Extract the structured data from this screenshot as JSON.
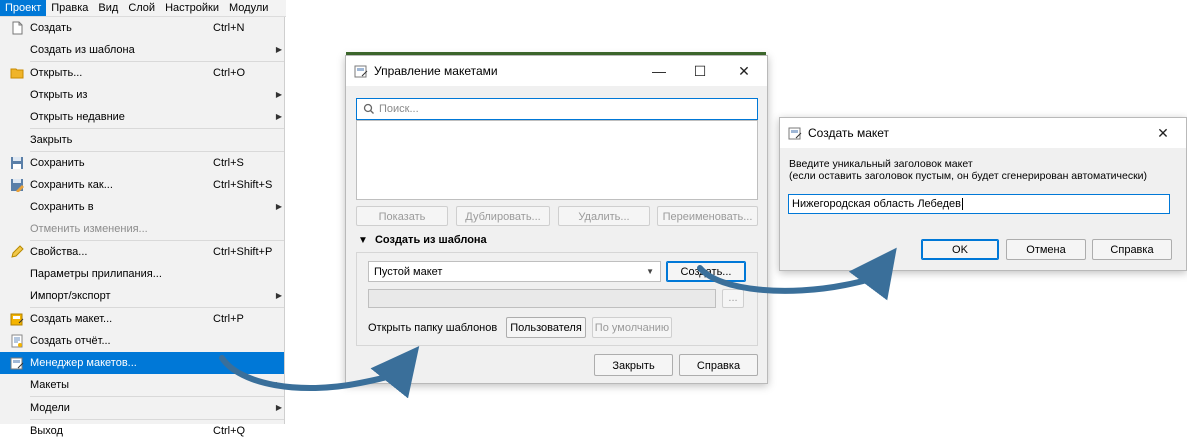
{
  "menubar": {
    "items": [
      "Проект",
      "Правка",
      "Вид",
      "Слой",
      "Настройки",
      "Модули"
    ]
  },
  "menu": {
    "items": [
      {
        "label": "Создать",
        "shortcut": "Ctrl+N",
        "icon": "new-file-icon"
      },
      {
        "label": "Создать из шаблона",
        "submenu": "▶"
      },
      {
        "label": "Открыть...",
        "shortcut": "Ctrl+O",
        "icon": "folder-icon"
      },
      {
        "label": "Открыть из",
        "submenu": "▶"
      },
      {
        "label": "Открыть недавние",
        "submenu": "▶"
      },
      {
        "label": "Закрыть"
      },
      {
        "label": "Сохранить",
        "shortcut": "Ctrl+S",
        "icon": "save-icon"
      },
      {
        "label": "Сохранить как...",
        "shortcut": "Ctrl+Shift+S",
        "icon": "save-as-icon"
      },
      {
        "label": "Сохранить в",
        "submenu": "▶"
      },
      {
        "label": "Отменить изменения..."
      },
      {
        "label": "Свойства...",
        "shortcut": "Ctrl+Shift+P",
        "icon": "properties-icon"
      },
      {
        "label": "Параметры прилипания..."
      },
      {
        "label": "Импорт/экспорт",
        "submenu": "▶"
      },
      {
        "label": "Создать макет...",
        "shortcut": "Ctrl+P",
        "icon": "new-layout-icon"
      },
      {
        "label": "Создать отчёт...",
        "icon": "new-report-icon"
      },
      {
        "label": "Менеджер макетов...",
        "icon": "layout-manager-icon"
      },
      {
        "label": "Макеты",
        "submenu": "▶"
      },
      {
        "label": "Модели",
        "submenu": "▶"
      },
      {
        "label": "Выход",
        "shortcut": "Ctrl+Q"
      }
    ]
  },
  "manager": {
    "title": "Управление макетами",
    "search_placeholder": "Поиск...",
    "btn_show": "Показать",
    "btn_duplicate": "Дублировать...",
    "btn_delete": "Удалить...",
    "btn_rename": "Переименовать...",
    "section_title": "Создать из шаблона",
    "template_value": "Пустой макет",
    "btn_create": "Создать...",
    "btn_browse": "...",
    "open_folder_label": "Открыть папку шаблонов",
    "btn_user": "Пользователя",
    "btn_default": "По умолчанию",
    "btn_close": "Закрыть",
    "btn_help": "Справка"
  },
  "create": {
    "title": "Создать макет",
    "prompt_line1": "Введите уникальный заголовок макет",
    "prompt_line2": "(если оставить заголовок пустым, он будет сгенерирован автоматически)",
    "input_value": "Нижегородская область Лебедев",
    "btn_ok": "OK",
    "btn_cancel": "Отмена",
    "btn_help": "Справка"
  },
  "window_controls": {
    "minimize": "—",
    "maximize": "☐",
    "close": "✕"
  },
  "colors": {
    "accent": "#0078d7",
    "arrow": "#3a6f9a"
  }
}
